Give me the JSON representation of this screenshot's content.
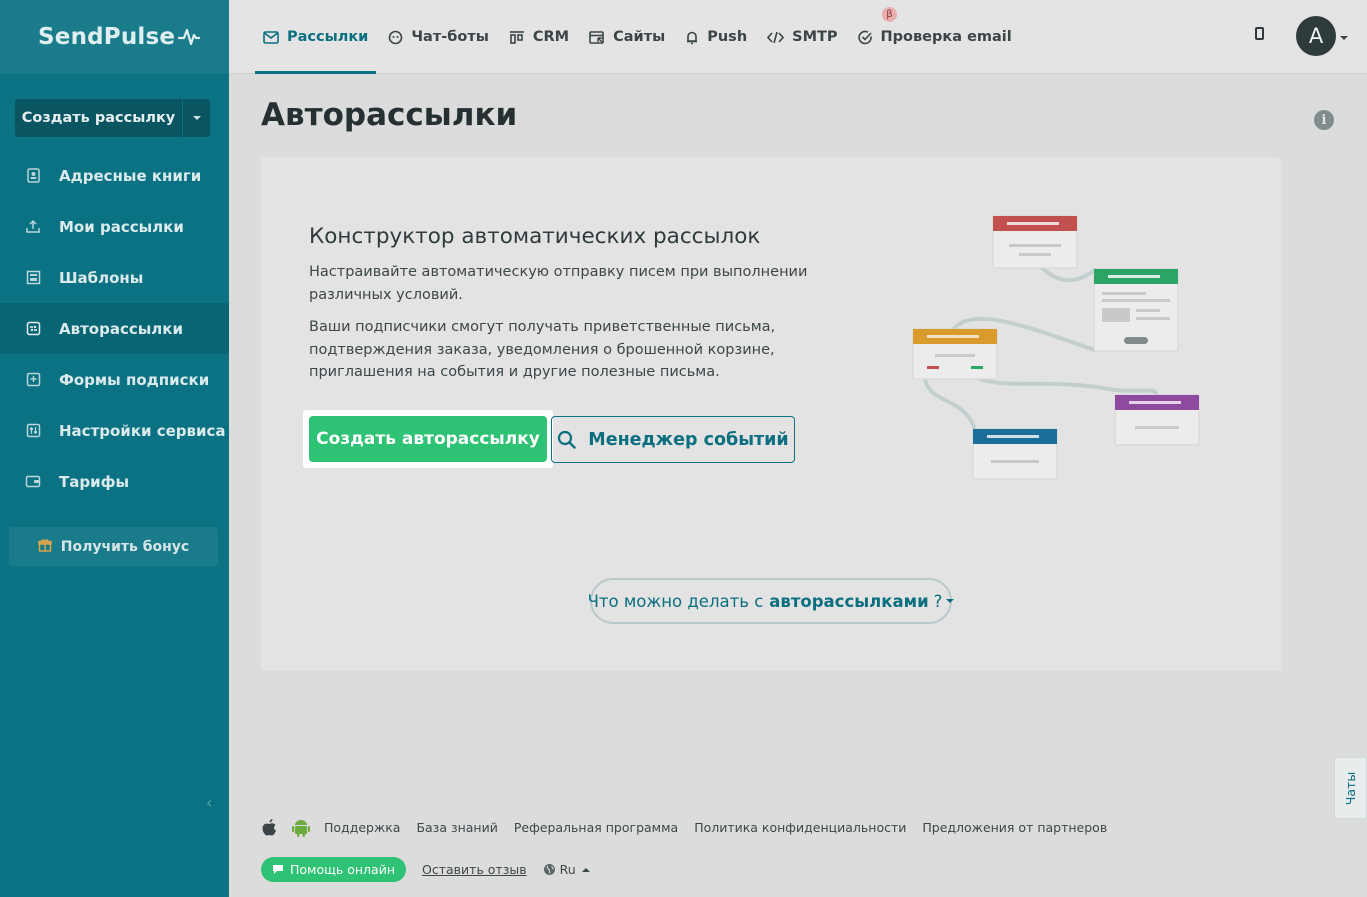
{
  "brand": {
    "name": "SendPulse"
  },
  "sidebar": {
    "create_button": "Создать рассылку",
    "items": [
      {
        "label": "Адресные книги",
        "icon": "address-book-icon"
      },
      {
        "label": "Мои рассылки",
        "icon": "mailing-icon"
      },
      {
        "label": "Шаблоны",
        "icon": "templates-icon"
      },
      {
        "label": "Авторассылки",
        "icon": "automation-icon",
        "active": true
      },
      {
        "label": "Формы подписки",
        "icon": "form-icon"
      },
      {
        "label": "Настройки сервиса",
        "icon": "settings-sliders-icon"
      },
      {
        "label": "Тарифы",
        "icon": "wallet-icon"
      }
    ],
    "bonus_button": "Получить бонус"
  },
  "topnav": {
    "tabs": [
      {
        "label": "Рассылки",
        "icon": "mail-icon",
        "active": true
      },
      {
        "label": "Чат-боты",
        "icon": "chatbot-icon"
      },
      {
        "label": "CRM",
        "icon": "crm-icon"
      },
      {
        "label": "Сайты",
        "icon": "sites-icon",
        "badge": "β"
      },
      {
        "label": "Push",
        "icon": "bell-icon"
      },
      {
        "label": "SMTP",
        "icon": "code-icon"
      },
      {
        "label": "Проверка email",
        "icon": "check-circle-icon"
      }
    ],
    "avatar_initial": "A"
  },
  "main": {
    "title": "Авторассылки",
    "card": {
      "heading": "Конструктор автоматических рассылок",
      "paragraph1": "Настраивайте автоматическую отправку писем при выполнении различных условий.",
      "paragraph2": "Ваши подписчики смогут получать приветственные письма, подтверждения заказа, уведомления о брошенной корзине, приглашения на события и другие полезные письма.",
      "create_button": "Создать авторассылку",
      "events_button": "Менеджер событий",
      "faq_prefix": "Что можно делать с",
      "faq_bold": "авторассылками",
      "faq_suffix": "?"
    }
  },
  "footer": {
    "links": [
      "Поддержка",
      "База знаний",
      "Реферальная программа",
      "Политика конфиденциальности",
      "Предложения от партнеров"
    ],
    "help_button": "Помощь онлайн",
    "review_link": "Оставить отзыв",
    "language": "Ru"
  },
  "chats_tab": "Чаты",
  "colors": {
    "sidebar": "#0b7283",
    "accent": "#0b6f80",
    "cta": "#2ec274"
  }
}
